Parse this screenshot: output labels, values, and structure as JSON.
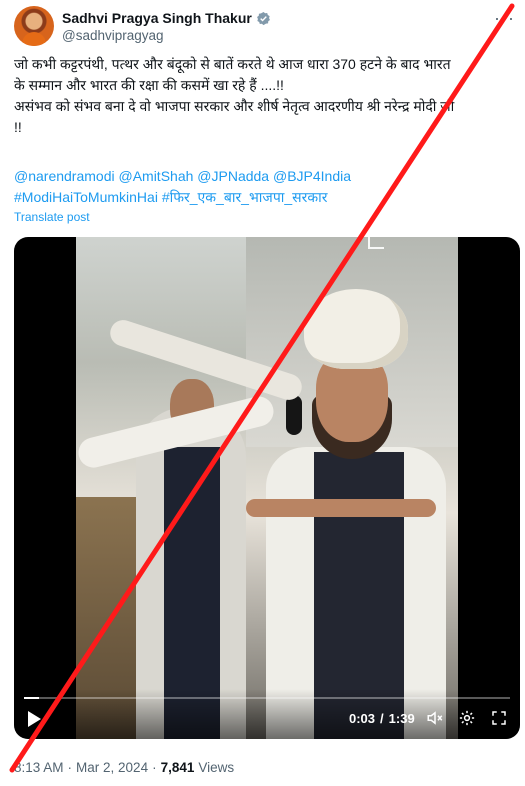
{
  "author": {
    "name": "Sadhvi Pragya Singh Thakur",
    "handle": "@sadhvipragyag",
    "more_label": "···"
  },
  "post": {
    "lines": [
      "जो कभी कट्टरपंथी, पत्थर और बंदूको से बातें करते थे आज धारा 370 हटने के बाद भारत",
      "के सम्मान और भारत की रक्षा की कसमें खा रहे हैं ....!!",
      "असंभव को संभव बना दे वो भाजपा सरकार और शीर्ष नेतृत्व आदरणीय श्री नरेन्द्र मोदी जी",
      "!!"
    ],
    "mentions": "@narendramodi @AmitShah @JPNadda @BJP4India",
    "hashtags": "#ModiHaiToMumkinHai #फिर_एक_बार_भाजपा_सरकार",
    "translate_label": "Translate post"
  },
  "video": {
    "current_time": "0:03",
    "separator": "/",
    "duration": "1:39",
    "progress_fraction": 0.03
  },
  "meta": {
    "time": "8:13 AM",
    "dot1": "·",
    "date": "Mar 2, 2024",
    "dot2": "·",
    "views_count": "7,841",
    "views_label": "Views"
  },
  "colors": {
    "link": "#1d9bf0",
    "secondary_text": "#536471",
    "verified_badge": "#829aab",
    "slash_line": "#ff1a1a"
  }
}
